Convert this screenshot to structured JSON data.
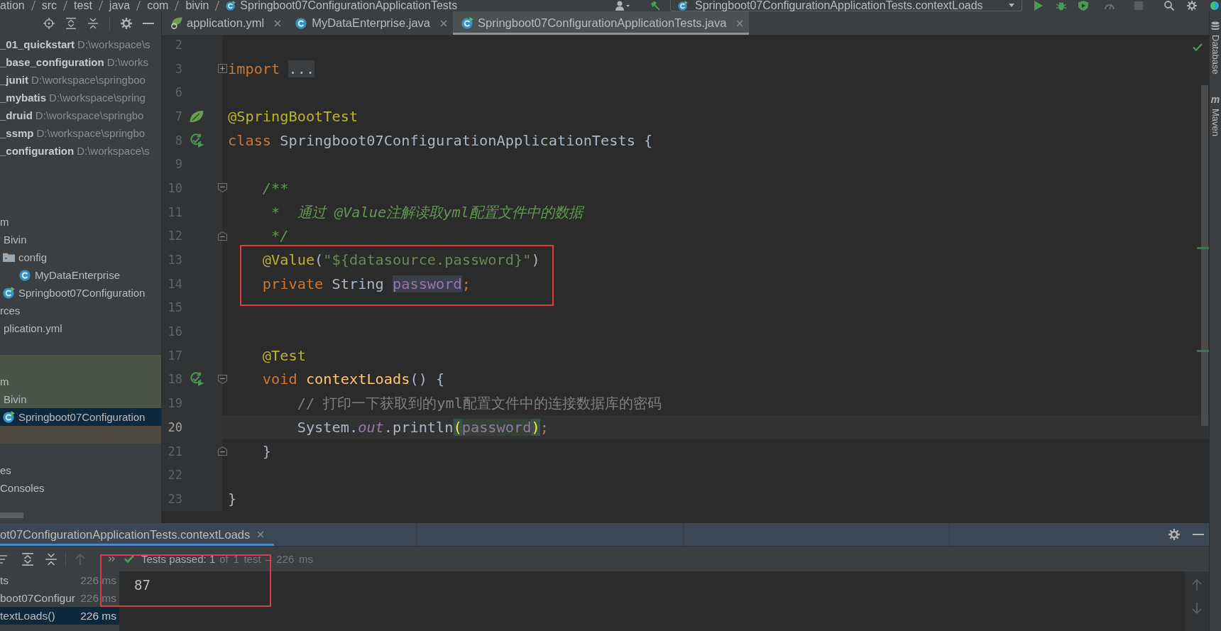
{
  "toolbar": {
    "breadcrumb": [
      {
        "label": "ation",
        "kind": "dir"
      },
      {
        "label": "src",
        "kind": "dir"
      },
      {
        "label": "test",
        "kind": "dir"
      },
      {
        "label": "java",
        "kind": "dir"
      },
      {
        "label": "com",
        "kind": "dir"
      },
      {
        "label": "bivin",
        "kind": "dir"
      },
      {
        "label": "Springboot07ConfigurationApplicationTests",
        "kind": "test"
      }
    ],
    "run_config": "Springboot07ConfigurationApplicationTests.contextLoads"
  },
  "project": {
    "modules": [
      {
        "name": "_01_quickstart",
        "path": "D:\\workspace\\s",
        "selected": false
      },
      {
        "name": "_base_configuration",
        "path": "D:\\works",
        "selected": false
      },
      {
        "name": "_junit",
        "path": "D:\\workspace\\springboo",
        "selected": false
      },
      {
        "name": "_mybatis",
        "path": "D:\\workspace\\spring",
        "selected": false
      },
      {
        "name": "_druid",
        "path": "D:\\workspace\\springbo",
        "selected": false
      },
      {
        "name": "_ssmp",
        "path": "D:\\workspace\\springbo",
        "selected": false
      },
      {
        "name": "_configuration",
        "path": "D:\\workspace\\s",
        "selected": false
      }
    ],
    "sections": [
      [
        {
          "label": "m",
          "selected": false,
          "children": [
            {
              "label": "Bivin",
              "selected": false,
              "children": [
                {
                  "label": "config",
                  "kind": "package",
                  "selected": false,
                  "children": [
                    {
                      "label": "MyDataEnterprise",
                      "kind": "class",
                      "selected": false
                    }
                  ]
                },
                {
                  "label": "Springboot07Configuration",
                  "kind": "test",
                  "selected": false
                }
              ]
            }
          ]
        },
        {
          "label": "rces",
          "selected": false,
          "children": [
            {
              "label": "plication.yml",
              "selected": false
            }
          ]
        }
      ],
      [
        {
          "color": "#4a5447",
          "selected": false
        },
        {
          "label": "m",
          "color": "#4a5447",
          "selected": false,
          "children": [
            {
              "label": "Bivin",
              "color": "#4a5447",
              "selected": false,
              "children": [
                {
                  "label": "Springboot07Configuration",
                  "kind": "test",
                  "selected": true
                }
              ]
            }
          ]
        },
        {
          "color": "#4d493e",
          "selected": false
        }
      ],
      [
        {
          "label": "es",
          "selected": false
        },
        {
          "label": "Consoles",
          "selected": false
        }
      ]
    ]
  },
  "editor": {
    "tabs": [
      {
        "label": "application.yml",
        "kind": "yml",
        "selected": false
      },
      {
        "label": "MyDataEnterprise.java",
        "kind": "class",
        "selected": false
      },
      {
        "label": "Springboot07ConfigurationApplicationTests.java",
        "kind": "test",
        "selected": true
      }
    ],
    "lines": [
      {
        "number": "2",
        "current": false
      },
      {
        "number": "3",
        "current": false,
        "fold": {
          "kind": "collapsed"
        },
        "tokens": [
          {
            "text": "import ",
            "kind": "kw"
          },
          {
            "text": "...",
            "kind": "fold"
          }
        ]
      },
      {
        "number": "6",
        "current": false
      },
      {
        "number": "7",
        "current": false,
        "gutter": {
          "kind": "bean"
        },
        "tokens": [
          {
            "text": "@SpringBootTest",
            "kind": "ann"
          }
        ]
      },
      {
        "number": "8",
        "current": false,
        "gutter": {
          "kind": "test"
        },
        "tokens": [
          {
            "text": "class ",
            "kind": "kw"
          },
          {
            "text": "Springboot07ConfigurationApplicationTests {",
            "kind": "txt"
          }
        ]
      },
      {
        "number": "9",
        "current": false
      },
      {
        "number": "10",
        "current": false,
        "fold": {
          "kind": "open"
        },
        "tokens": [
          {
            "text": "    /**",
            "kind": "doc"
          }
        ]
      },
      {
        "number": "11",
        "current": false,
        "tokens": [
          {
            "text": "     *  通过 @Value注解读取yml配置文件中的数据",
            "kind": "doc"
          }
        ]
      },
      {
        "number": "12",
        "current": false,
        "fold": {
          "kind": "end"
        },
        "tokens": [
          {
            "text": "     */",
            "kind": "doc"
          }
        ]
      },
      {
        "number": "13",
        "current": false,
        "tokens": [
          {
            "text": "    @Value",
            "kind": "ann"
          },
          {
            "text": "(",
            "kind": "txt"
          },
          {
            "text": "\"${datasource.password}\"",
            "kind": "str"
          },
          {
            "text": ")",
            "kind": "txt"
          }
        ]
      },
      {
        "number": "14",
        "current": false,
        "tokens": [
          {
            "text": "    private ",
            "kind": "kw"
          },
          {
            "text": "String ",
            "kind": "txt"
          },
          {
            "text": "password",
            "kind": "decl"
          },
          {
            "text": ";",
            "kind": "kw"
          }
        ]
      },
      {
        "number": "15",
        "current": false
      },
      {
        "number": "16",
        "current": false
      },
      {
        "number": "17",
        "current": false,
        "tokens": [
          {
            "text": "    @Test",
            "kind": "ann"
          }
        ]
      },
      {
        "number": "18",
        "current": false,
        "gutter": {
          "kind": "test"
        },
        "fold": {
          "kind": "open"
        },
        "tokens": [
          {
            "text": "    void ",
            "kind": "kw"
          },
          {
            "text": "contextLoads",
            "kind": "mth"
          },
          {
            "text": "() {",
            "kind": "txt"
          }
        ]
      },
      {
        "number": "19",
        "current": false,
        "tokens": [
          {
            "text": "        // 打印一下获取到的yml配置文件中的连接数据库的密码",
            "kind": "cmt"
          }
        ]
      },
      {
        "number": "20",
        "current": true,
        "tokens": [
          {
            "text": "        System.",
            "kind": "txt"
          },
          {
            "text": "out",
            "kind": "stat"
          },
          {
            "text": ".println",
            "kind": "txt"
          },
          {
            "text": "(",
            "kind": "brace"
          },
          {
            "text": "password",
            "kind": "use"
          },
          {
            "text": ")",
            "kind": "brace"
          },
          {
            "text": ";",
            "kind": "kw"
          }
        ]
      },
      {
        "number": "21",
        "current": false,
        "fold": {
          "kind": "end"
        },
        "tokens": [
          {
            "text": "    }",
            "kind": "txt"
          }
        ]
      },
      {
        "number": "22",
        "current": false
      },
      {
        "number": "23",
        "current": false,
        "tokens": [
          {
            "text": "}",
            "kind": "txt"
          }
        ]
      }
    ]
  },
  "tool_stripe": [
    {
      "label": "Database",
      "kind": "database"
    },
    {
      "label": "Maven",
      "kind": "maven",
      "icon": "m"
    }
  ],
  "run_panel": {
    "tabs": [
      {
        "label": "ot07ConfigurationApplicationTests.contextLoads",
        "selected": true
      }
    ],
    "status": "Tests passed: 1",
    "summary": "of 1 test – 226 ms",
    "tests": [
      {
        "label": "ts",
        "time": "226 ms",
        "selected": false,
        "children": [
          {
            "label": "boot07Configur",
            "time": "226 ms",
            "selected": false,
            "children": [
              {
                "label": "textLoads()",
                "time": "226 ms",
                "selected": true
              }
            ]
          }
        ]
      }
    ],
    "output": "87"
  }
}
